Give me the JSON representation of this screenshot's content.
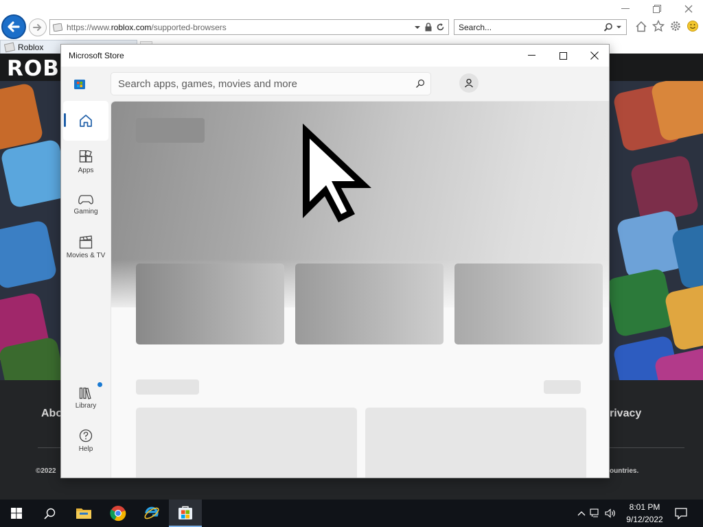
{
  "browser": {
    "url_prefix": "https://www.",
    "url_host": "roblox.com",
    "url_path": "/supported-browsers",
    "search_placeholder": "Search...",
    "tab_label": "Roblox"
  },
  "roblox_page": {
    "logo": "ROBLOX",
    "footer_about": "Abo",
    "footer_privacy": "rivacy",
    "footer_copyright": "©2022",
    "footer_countries": "ountries."
  },
  "store": {
    "window_title": "Microsoft Store",
    "search_placeholder": "Search apps, games, movies and more",
    "nav": {
      "apps": "Apps",
      "gaming": "Gaming",
      "movies": "Movies & TV",
      "library": "Library",
      "help": "Help"
    }
  },
  "taskbar": {
    "time": "8:01 PM",
    "date": "9/12/2022"
  },
  "colors": {
    "ie_accent": "#1c6fc9",
    "store_accent": "#1f5fa8",
    "taskbar": "#101318"
  },
  "icons": [
    "back-icon",
    "forward-icon",
    "lock-icon",
    "refresh-icon",
    "search-icon",
    "home-icon",
    "star-icon",
    "gear-icon",
    "smiley-icon",
    "store-logo-icon",
    "apps-icon",
    "gaming-icon",
    "movies-icon",
    "library-icon",
    "help-icon",
    "account-icon",
    "windows-start-icon",
    "file-explorer-icon",
    "chrome-icon",
    "ie-icon"
  ]
}
